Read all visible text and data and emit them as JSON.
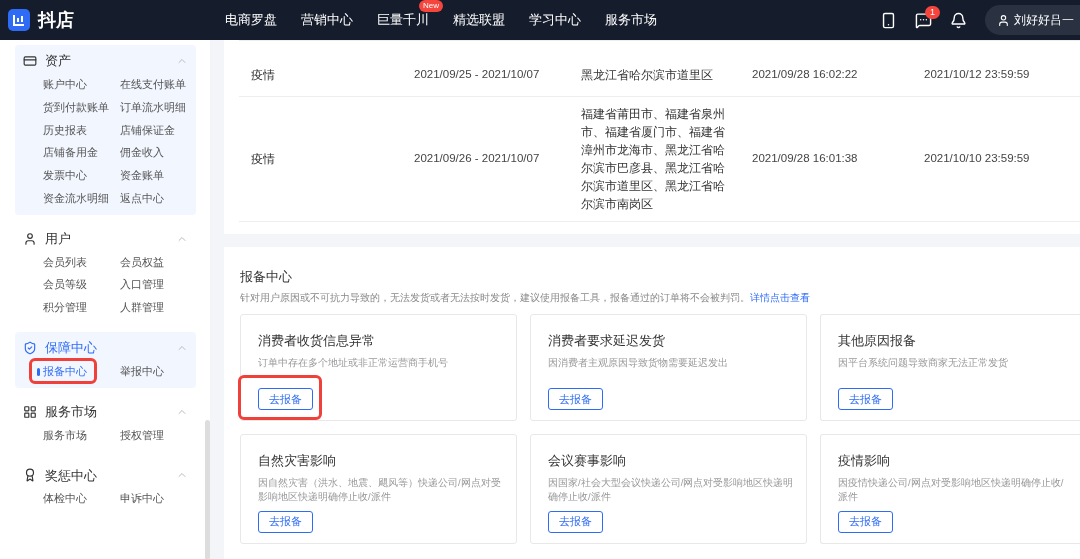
{
  "header": {
    "logo_text": "抖店",
    "nav": [
      {
        "label": "电商罗盘"
      },
      {
        "label": "营销中心"
      },
      {
        "label": "巨量千川",
        "badge": "New"
      },
      {
        "label": "精选联盟"
      },
      {
        "label": "学习中心"
      },
      {
        "label": "服务市场"
      }
    ],
    "message_count": "1",
    "user_name": "刘好好吕一"
  },
  "sidebar": {
    "groups": [
      {
        "title": "资产",
        "kind": "wallet",
        "active": false,
        "items": [
          {
            "label": "账户中心",
            "selected": false,
            "highlighted": false
          },
          {
            "label": "在线支付账单",
            "selected": false,
            "highlighted": false
          },
          {
            "label": "货到付款账单",
            "selected": false,
            "highlighted": false
          },
          {
            "label": "订单流水明细",
            "selected": false,
            "highlighted": false
          },
          {
            "label": "历史报表",
            "selected": false,
            "highlighted": false
          },
          {
            "label": "店铺保证金",
            "selected": false,
            "highlighted": false
          },
          {
            "label": "店铺备用金",
            "selected": false,
            "highlighted": false
          },
          {
            "label": "佣金收入",
            "selected": false,
            "highlighted": false
          },
          {
            "label": "发票中心",
            "selected": false,
            "highlighted": false
          },
          {
            "label": "资金账单",
            "selected": false,
            "highlighted": false
          },
          {
            "label": "资金流水明细",
            "selected": false,
            "highlighted": false
          },
          {
            "label": "返点中心",
            "selected": false,
            "highlighted": false
          }
        ]
      },
      {
        "title": "用户",
        "kind": "user",
        "active": false,
        "items": [
          {
            "label": "会员列表",
            "selected": false,
            "highlighted": false
          },
          {
            "label": "会员权益",
            "selected": false,
            "highlighted": false
          },
          {
            "label": "会员等级",
            "selected": false,
            "highlighted": false
          },
          {
            "label": "入口管理",
            "selected": false,
            "highlighted": false
          },
          {
            "label": "积分管理",
            "selected": false,
            "highlighted": false
          },
          {
            "label": "人群管理",
            "selected": false,
            "highlighted": false
          }
        ]
      },
      {
        "title": "保障中心",
        "kind": "shield",
        "active": true,
        "items": [
          {
            "label": "报备中心",
            "selected": true,
            "highlighted": true
          },
          {
            "label": "举报中心",
            "selected": false,
            "highlighted": false
          }
        ]
      },
      {
        "title": "服务市场",
        "kind": "grid",
        "active": false,
        "items": [
          {
            "label": "服务市场",
            "selected": false,
            "highlighted": false
          },
          {
            "label": "授权管理",
            "selected": false,
            "highlighted": false
          }
        ]
      },
      {
        "title": "奖惩中心",
        "kind": "award",
        "active": false,
        "items": [
          {
            "label": "体检中心",
            "selected": false,
            "highlighted": false
          },
          {
            "label": "申诉中心",
            "selected": false,
            "highlighted": false
          }
        ]
      }
    ]
  },
  "table": {
    "rows": [
      {
        "type": "疫情",
        "period": "2021/09/25 - 2021/10/07",
        "region": "黑龙江省哈尔滨市道里区",
        "created": "2021/09/28 16:02:22",
        "deadline": "2021/10/12 23:59:59"
      },
      {
        "type": "疫情",
        "period": "2021/09/26 - 2021/10/07",
        "region": "福建省莆田市、福建省泉州市、福建省厦门市、福建省漳州市龙海市、黑龙江省哈尔滨市巴彦县、黑龙江省哈尔滨市道里区、黑龙江省哈尔滨市南岗区",
        "created": "2021/09/28 16:01:38",
        "deadline": "2021/10/10 23:59:59"
      }
    ]
  },
  "report_center": {
    "title": "报备中心",
    "description": "针对用户原因或不可抗力导致的，无法发货或者无法按时发货，建议使用报备工具，报备通过的订单将不会被判罚。",
    "link": "详情点击查看",
    "cards": [
      {
        "title": "消费者收货信息异常",
        "description": "订单中存在多个地址或非正常运营商手机号",
        "button": "去报备",
        "highlighted": true
      },
      {
        "title": "消费者要求延迟发货",
        "description": "因消费者主观原因导致货物需要延迟发出",
        "button": "去报备",
        "highlighted": false
      },
      {
        "title": "其他原因报备",
        "description": "因平台系统问题导致商家无法正常发货",
        "button": "去报备",
        "highlighted": false
      },
      {
        "title": "自然灾害影响",
        "description": "因自然灾害（洪水、地震、飓风等）快递公司/网点对受影响地区快递明确停止收/派件",
        "button": "去报备",
        "highlighted": false
      },
      {
        "title": "会议赛事影响",
        "description": "因国家/社会大型会议快递公司/网点对受影响地区快递明确停止收/派件",
        "button": "去报备",
        "highlighted": false
      },
      {
        "title": "疫情影响",
        "description": "因疫情快递公司/网点对受影响地区快递明确停止收/派件",
        "button": "去报备",
        "highlighted": false
      }
    ]
  }
}
